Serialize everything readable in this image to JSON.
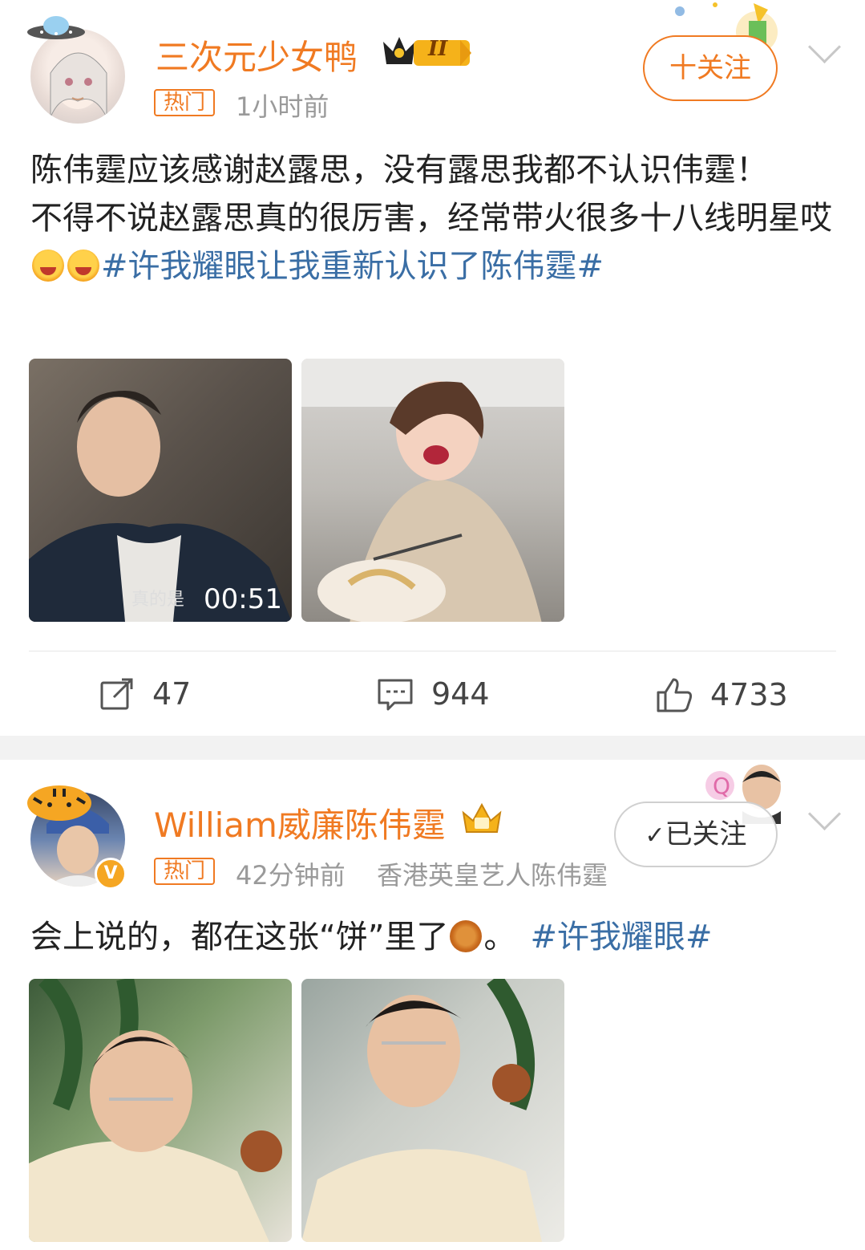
{
  "post1": {
    "username": "三次元少女鸭",
    "level_badge": "II",
    "hot_tag": "热门",
    "time": "1小时前",
    "follow_label": "十关注",
    "text_line1": "陈伟霆应该感谢赵露思，没有露思我都不认识伟霆！",
    "text_line2": "不得不说赵露思真的很厉害，经常带火很多十八线明星哎",
    "topic": "#许我耀眼让我重新认识了陈伟霆#",
    "video_caption": "真的是",
    "video_duration": "00:51",
    "actions": {
      "repost_count": "47",
      "comment_count": "944",
      "like_count": "4733"
    },
    "colors": {
      "accent": "#f07a22",
      "topic": "#3a6ea5"
    }
  },
  "post2": {
    "username": "William威廉陈伟霆",
    "hot_tag": "热门",
    "time": "42分钟前",
    "source": "香港英皇艺人陈伟霆",
    "follow_label": "已关注",
    "verified_badge": "V",
    "text_a": "会上说的，都在这张“饼”里了",
    "text_b": "。",
    "topic": "#许我耀眼#"
  }
}
